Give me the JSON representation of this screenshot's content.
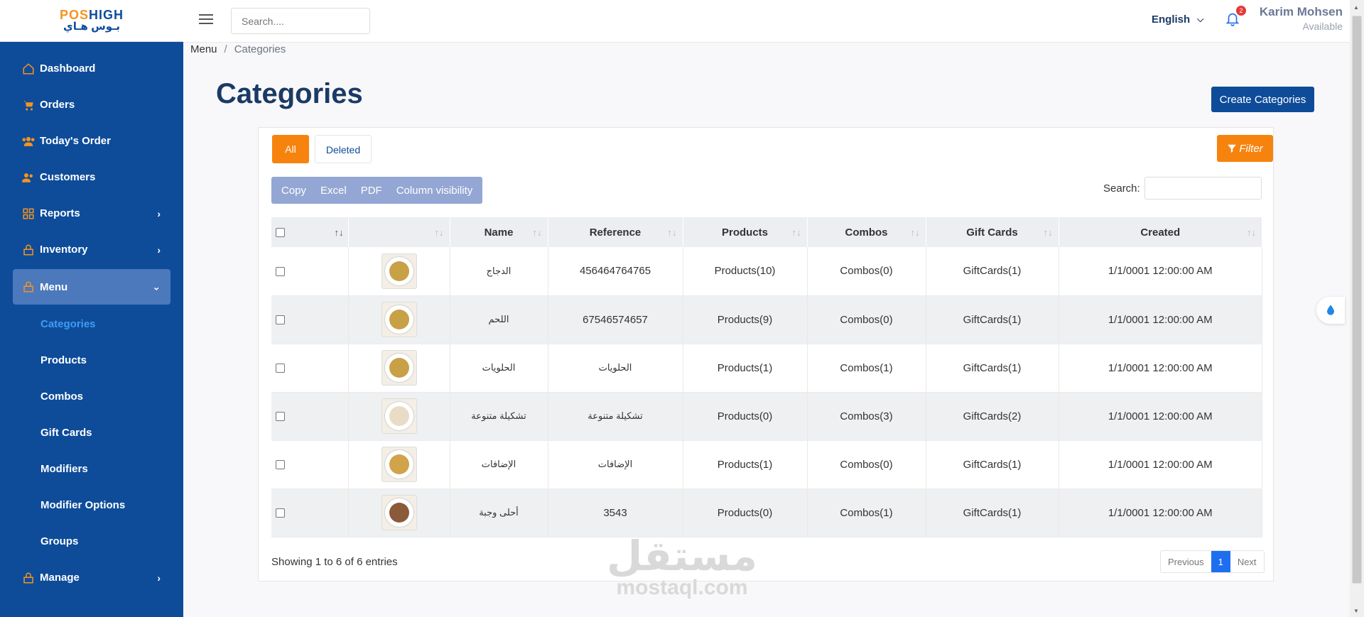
{
  "logo": {
    "top_a": "POS",
    "top_b": "HIGH",
    "bottom": "بـوس هـاي"
  },
  "sidebar": {
    "items": [
      {
        "label": "Dashboard"
      },
      {
        "label": "Orders"
      },
      {
        "label": "Today's Order"
      },
      {
        "label": "Customers"
      },
      {
        "label": "Reports"
      },
      {
        "label": "Inventory"
      },
      {
        "label": "Menu"
      },
      {
        "label": "Manage"
      }
    ],
    "submenu": [
      "Categories",
      "Products",
      "Combos",
      "Gift Cards",
      "Modifiers",
      "Modifier Options",
      "Groups"
    ]
  },
  "topbar": {
    "search_placeholder": "Search....",
    "language": "English",
    "notification_count": "2",
    "user_name": "Karim Mohsen",
    "user_status": "Available"
  },
  "breadcrumb": {
    "parent": "Menu",
    "separator": "/",
    "current": "Categories"
  },
  "page": {
    "title": "Categories",
    "create_button": "Create Categories"
  },
  "tabs": {
    "all": "All",
    "deleted": "Deleted"
  },
  "filter_label": "Filter",
  "export_buttons": [
    "Copy",
    "Excel",
    "PDF",
    "Column visibility"
  ],
  "search_label": "Search:",
  "table": {
    "headers": [
      "Name",
      "Reference",
      "Products",
      "Combos",
      "Gift Cards",
      "Created"
    ],
    "rows": [
      {
        "name": "الدجاج",
        "reference": "456464764765",
        "products": "Products(10)",
        "combos": "Combos(0)",
        "giftcards": "GiftCards(1)",
        "created": "1/1/0001 12:00:00 AM"
      },
      {
        "name": "اللحم",
        "reference": "67546574657",
        "products": "Products(9)",
        "combos": "Combos(0)",
        "giftcards": "GiftCards(1)",
        "created": "1/1/0001 12:00:00 AM"
      },
      {
        "name": "الحلويات",
        "reference": "الحلويات",
        "products": "Products(1)",
        "combos": "Combos(1)",
        "giftcards": "GiftCards(1)",
        "created": "1/1/0001 12:00:00 AM"
      },
      {
        "name": "تشكيلة متنوعة",
        "reference": "تشكيلة متنوعة",
        "products": "Products(0)",
        "combos": "Combos(3)",
        "giftcards": "GiftCards(2)",
        "created": "1/1/0001 12:00:00 AM"
      },
      {
        "name": "الإضافات",
        "reference": "الإضافات",
        "products": "Products(1)",
        "combos": "Combos(0)",
        "giftcards": "GiftCards(1)",
        "created": "1/1/0001 12:00:00 AM"
      },
      {
        "name": "أحلى وجبة",
        "reference": "3543",
        "products": "Products(0)",
        "combos": "Combos(1)",
        "giftcards": "GiftCards(1)",
        "created": "1/1/0001 12:00:00 AM"
      }
    ]
  },
  "footer": {
    "showing": "Showing 1 to 6 of 6 entries",
    "previous": "Previous",
    "page": "1",
    "next": "Next"
  },
  "watermark": {
    "arabic": "مستقل",
    "latin": "mostaql.com"
  },
  "colors": {
    "sidebar": "#0e4c9a",
    "accent": "#f7830f",
    "active_link": "#3d9df5"
  }
}
